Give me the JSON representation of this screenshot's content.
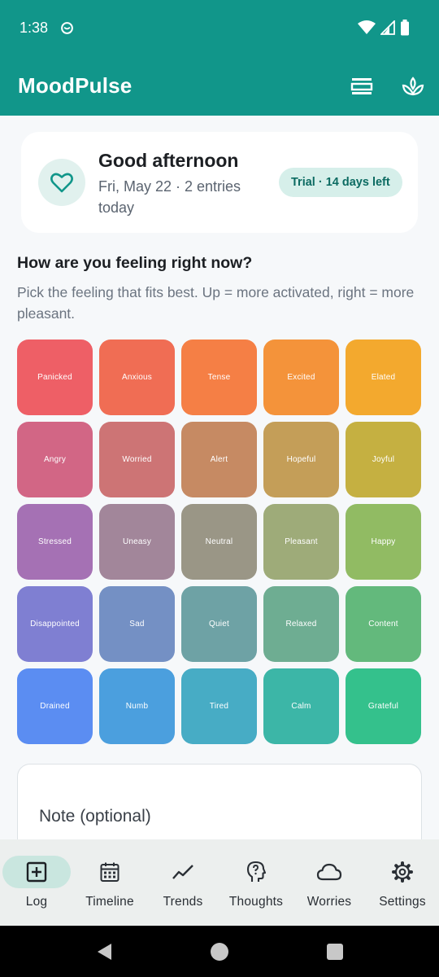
{
  "status": {
    "time": "1:38"
  },
  "app": {
    "title": "MoodPulse"
  },
  "greeting": {
    "title": "Good afternoon",
    "subtitle": "Fri, May 22 · 2 entries today",
    "trial": "Trial · 14 days left"
  },
  "prompt": {
    "question": "How are you feeling right now?",
    "hint": "Pick the feeling that fits best. Up = more activated, right = more pleasant."
  },
  "moods": [
    {
      "label": "Panicked",
      "color": "#ee5f66"
    },
    {
      "label": "Anxious",
      "color": "#f06d54"
    },
    {
      "label": "Tense",
      "color": "#f57f45"
    },
    {
      "label": "Excited",
      "color": "#f4933a"
    },
    {
      "label": "Elated",
      "color": "#f3a92e"
    },
    {
      "label": "Angry",
      "color": "#d26685"
    },
    {
      "label": "Worried",
      "color": "#cd7475"
    },
    {
      "label": "Alert",
      "color": "#c68a63"
    },
    {
      "label": "Hopeful",
      "color": "#c49e58"
    },
    {
      "label": "Joyful",
      "color": "#c5b041"
    },
    {
      "label": "Stressed",
      "color": "#a571b4"
    },
    {
      "label": "Uneasy",
      "color": "#a2869a"
    },
    {
      "label": "Neutral",
      "color": "#9a9686"
    },
    {
      "label": "Pleasant",
      "color": "#9eab79"
    },
    {
      "label": "Happy",
      "color": "#91bb63"
    },
    {
      "label": "Disappointed",
      "color": "#7f7fd2"
    },
    {
      "label": "Sad",
      "color": "#7490c4"
    },
    {
      "label": "Quiet",
      "color": "#6ea2a5"
    },
    {
      "label": "Relaxed",
      "color": "#6ead92"
    },
    {
      "label": "Content",
      "color": "#63b97c"
    },
    {
      "label": "Drained",
      "color": "#5b8df2"
    },
    {
      "label": "Numb",
      "color": "#4b9fde"
    },
    {
      "label": "Tired",
      "color": "#47acc5"
    },
    {
      "label": "Calm",
      "color": "#3cb6a7"
    },
    {
      "label": "Grateful",
      "color": "#34c18c"
    }
  ],
  "note": {
    "label": "Note (optional)"
  },
  "nav": [
    {
      "label": "Log",
      "icon": "plus-square-icon",
      "active": true
    },
    {
      "label": "Timeline",
      "icon": "calendar-icon",
      "active": false
    },
    {
      "label": "Trends",
      "icon": "trend-line-icon",
      "active": false
    },
    {
      "label": "Thoughts",
      "icon": "head-question-icon",
      "active": false
    },
    {
      "label": "Worries",
      "icon": "cloud-icon",
      "active": false
    },
    {
      "label": "Settings",
      "icon": "gear-icon",
      "active": false
    }
  ],
  "colors": {
    "primary": "#11968a",
    "trial_bg": "#d6efea",
    "nav_active": "#c9e6df"
  }
}
